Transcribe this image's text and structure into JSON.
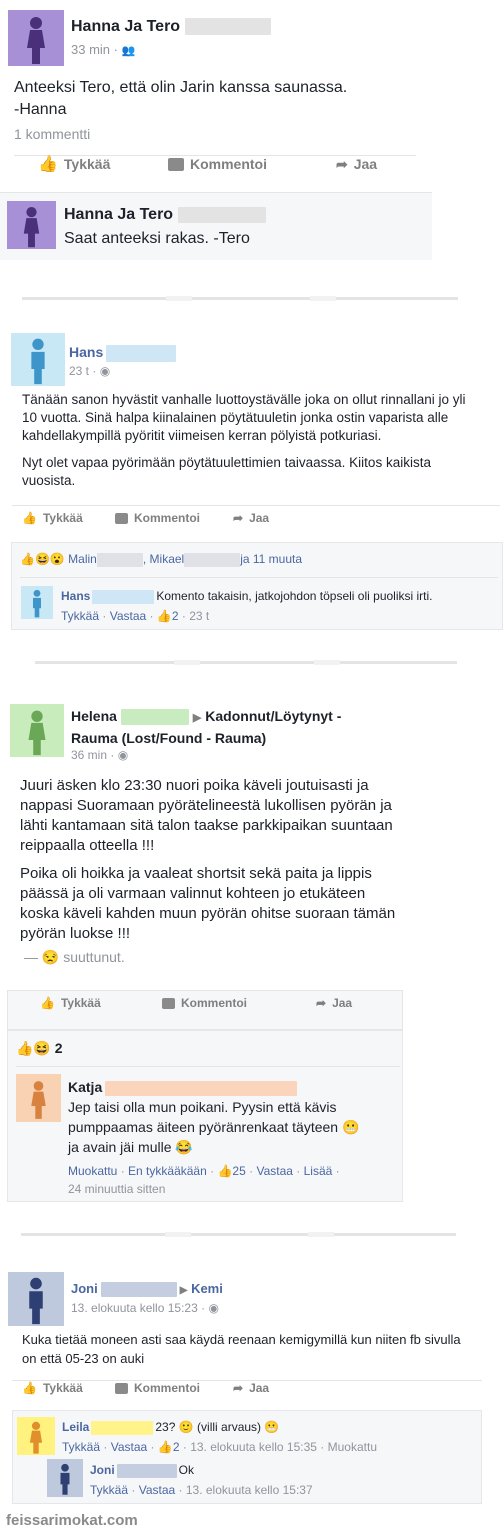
{
  "post1": {
    "author": "Hanna Ja Tero",
    "time": "33 min",
    "dot": "·",
    "line1": "Anteeksi Tero, että olin Jarin kanssa saunassa.",
    "line2": "-Hanna",
    "comment_count": "1 kommentti",
    "like": "Tykkää",
    "comment": "Kommentoi",
    "share": "Jaa",
    "reply_author": "Hanna Ja Tero",
    "reply_text": "Saat anteeksi rakas. -Tero"
  },
  "post2": {
    "author": "Hans",
    "time": "23 t",
    "dot": "·",
    "para1": "Tänään sanon hyvästit vanhalle luottoystävälle joka on ollut rinnallani jo yli 10 vuotta. Sinä halpa kiinalainen pöytätuuletin jonka ostin vaparista alle kahdellakympillä pyöritit viimeisen kerran pölyistä potkuriasi.",
    "para2": "Nyt olet vapaa pyörimään pöytätuulettimien taivaassa. Kiitos kaikista vuosista.",
    "like": "Tykkää",
    "comment": "Kommentoi",
    "share": "Jaa",
    "reactors_a": "Malin",
    "reactors_b": ", Mikael",
    "reactors_c": "ja 11 muuta",
    "c_author": "Hans",
    "c_text": "Komento takaisin, jatkojohdon töpseli oli puoliksi irti.",
    "c_like": "Tykkää",
    "c_sep": "·",
    "c_reply": "Vastaa",
    "c_likes": "2",
    "c_time": "23 t"
  },
  "post3": {
    "author": "Helena",
    "group": "Kadonnut/Löytynyt - Rauma (Lost/Found - Rauma)",
    "time": "36 min",
    "dot": "·",
    "para1": "Juuri äsken klo 23:30 nuori poika käveli joutuisasti ja nappasi Suoramaan pyörätelineestä lukollisen pyörän ja lähti kantamaan sitä talon taakse parkkipaikan suuntaan reippaalla otteella !!!",
    "para2": "Poika oli hoikka ja vaaleat shortsit sekä paita ja lippis päässä ja oli varmaan valinnut kohteen jo etukäteen koska käveli kahden muun pyörän ohitse suoraan tämän pyörän luokse !!!",
    "feeling_dash": "—",
    "feeling": "suuttunut.",
    "like": "Tykkää",
    "comment": "Kommentoi",
    "share": "Jaa",
    "reaction_count": "2",
    "c_author": "Katja",
    "c_text1": "Jep taisi olla mun poikani. Pyysin että kävis",
    "c_text2": "pumppaamas äiteen pyöränrenkaat täyteen",
    "c_text3": "ja avain jäi mulle",
    "c_edited": "Muokattu",
    "c_sep": "·",
    "c_dislike": "En tykkääkään",
    "c_likes": "25",
    "c_reply": "Vastaa",
    "c_more": "Lisää",
    "c_time": "24 minuuttia sitten"
  },
  "post4": {
    "author": "Joni",
    "place": "Kemi",
    "time": "13. elokuuta kello 15:23",
    "dot": "·",
    "text": "Kuka tietää moneen asti saa käydä reenaan kemigymillä kun niiten fb sivulla on että 05-23 on auki",
    "like": "Tykkää",
    "comment": "Kommentoi",
    "share": "Jaa",
    "c1_author": "Leila",
    "c1_text_a": "23?",
    "c1_text_b": "(villi arvaus)",
    "c1_like": "Tykkää",
    "c1_sep": "·",
    "c1_reply": "Vastaa",
    "c1_likes": "2",
    "c1_time": "13. elokuuta kello 15:35",
    "c1_edited": "Muokattu",
    "c2_author": "Joni",
    "c2_text": "Ok",
    "c2_like": "Tykkää",
    "c2_sep": "·",
    "c2_reply": "Vastaa",
    "c2_time": "13. elokuuta kello 15:37"
  },
  "watermark": "feissarimokat.com",
  "colors": {
    "avatar_purple": "#9b7fc6",
    "avatar_blue": "#9fd3ec",
    "avatar_green": "#bfe8b0",
    "avatar_orange": "#f7c8a8",
    "avatar_navy": "#b7c3dc",
    "avatar_yellow": "#fff07a",
    "link_blue": "#4b67a1"
  }
}
